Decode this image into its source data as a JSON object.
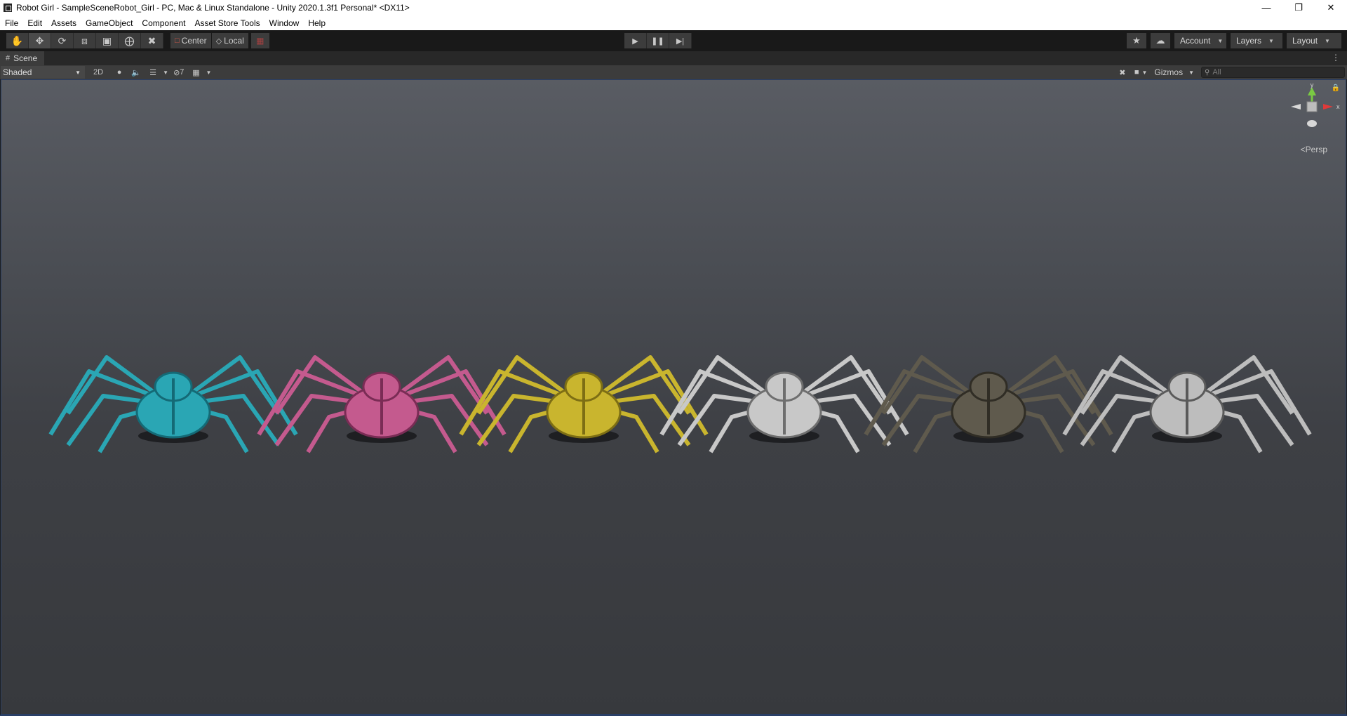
{
  "window": {
    "title": "Robot Girl - SampleSceneRobot_Girl - PC, Mac & Linux Standalone - Unity 2020.1.3f1 Personal* <DX11>",
    "controls": [
      "minimize",
      "restore",
      "close"
    ]
  },
  "menu": {
    "items": [
      "File",
      "Edit",
      "Assets",
      "GameObject",
      "Component",
      "Asset Store Tools",
      "Window",
      "Help"
    ]
  },
  "toolbar": {
    "tools": [
      {
        "name": "hand-tool",
        "icon": "hand-icon"
      },
      {
        "name": "move-tool",
        "icon": "move-icon",
        "active": true
      },
      {
        "name": "rotate-tool",
        "icon": "rotate-icon"
      },
      {
        "name": "scale-tool",
        "icon": "scale-icon"
      },
      {
        "name": "rect-tool",
        "icon": "rect-icon"
      },
      {
        "name": "transform-tool",
        "icon": "transform-icon"
      },
      {
        "name": "custom-tool",
        "icon": "tools-icon"
      }
    ],
    "pivot_position": "Center",
    "pivot_rotation": "Local",
    "account_label": "Account",
    "layers_label": "Layers",
    "layout_label": "Layout"
  },
  "scene": {
    "tab_label": "Scene",
    "shading_mode": "Shaded",
    "two_d_label": "2D",
    "hidden_count": "7",
    "gizmos_label": "Gizmos",
    "search_placeholder": "All",
    "persp_label": "Persp",
    "axis_x": "x",
    "axis_y": "y",
    "spiders": [
      {
        "color": "#2aa6b4",
        "dark": "#146a76"
      },
      {
        "color": "#c45a8e",
        "dark": "#7a2c55"
      },
      {
        "color": "#c9b52e",
        "dark": "#7d6e14"
      },
      {
        "color": "#c8c8c8",
        "dark": "#6e6e6e"
      },
      {
        "color": "#5f5a4d",
        "dark": "#302d25"
      },
      {
        "color": "#bdbdbd",
        "dark": "#5a5a5a"
      }
    ]
  },
  "colors": {
    "accent_blue": "#2a3f66",
    "x_axis": "#e03a3a",
    "y_axis": "#7ac943"
  }
}
